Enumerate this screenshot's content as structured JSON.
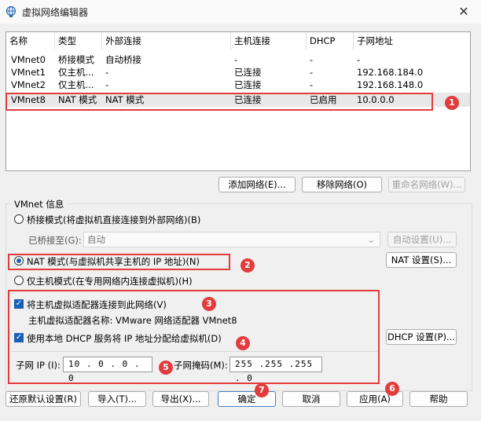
{
  "window": {
    "title": "虚拟网络编辑器",
    "close": "✕"
  },
  "table": {
    "columns": [
      "名称",
      "类型",
      "外部连接",
      "主机连接",
      "DHCP",
      "子网地址"
    ],
    "rows": [
      [
        "VMnet0",
        "桥接模式",
        "自动桥接",
        "-",
        "-",
        "-"
      ],
      [
        "VMnet1",
        "仅主机...",
        "-",
        "已连接",
        "-",
        "192.168.184.0"
      ],
      [
        "VMnet2",
        "仅主机...",
        "-",
        "已连接",
        "-",
        "192.168.148.0"
      ],
      [
        "VMnet8",
        "NAT 模式",
        "NAT 模式",
        "已连接",
        "已启用",
        "10.0.0.0"
      ]
    ],
    "selected_row": 3
  },
  "list_buttons": {
    "add": "添加网络(E)...",
    "remove": "移除网络(O)",
    "rename": "重命名网络(W)..."
  },
  "group": {
    "title": "VMnet 信息",
    "bridge_radio": "桥接模式(将虚拟机直接连接到外部网络)(B)",
    "bridged_to_label": "已桥接至(G):",
    "bridged_to_value": "自动",
    "auto_settings": "自动设置(U)...",
    "nat_radio": "NAT 模式(与虚拟机共享主机的 IP 地址)(N)",
    "nat_settings": "NAT 设置(S)...",
    "hostonly_radio": "仅主机模式(在专用网络内连接虚拟机)(H)",
    "connect_adapter": "将主机虚拟适配器连接到此网络(V)",
    "adapter_name": "主机虚拟适配器名称: VMware 网络适配器 VMnet8",
    "use_dhcp": "使用本地 DHCP 服务将 IP 地址分配给虚拟机(D)",
    "dhcp_settings": "DHCP 设置(P)...",
    "subnet_ip_label": "子网 IP (I):",
    "subnet_ip_value": "10 . 0 . 0 . 0",
    "subnet_mask_label": "子网掩码(M):",
    "subnet_mask_value": "255 .255 .255 . 0"
  },
  "bottom_buttons": {
    "restore": "还原默认设置(R)",
    "import": "导入(T)...",
    "export": "导出(X)...",
    "ok": "确定",
    "cancel": "取消",
    "apply": "应用(A)",
    "help": "帮助"
  },
  "badges": [
    "1",
    "2",
    "3",
    "4",
    "5",
    "6",
    "7"
  ],
  "colors": {
    "annotation": "#e23c3c",
    "accent": "#1a5fb4"
  }
}
